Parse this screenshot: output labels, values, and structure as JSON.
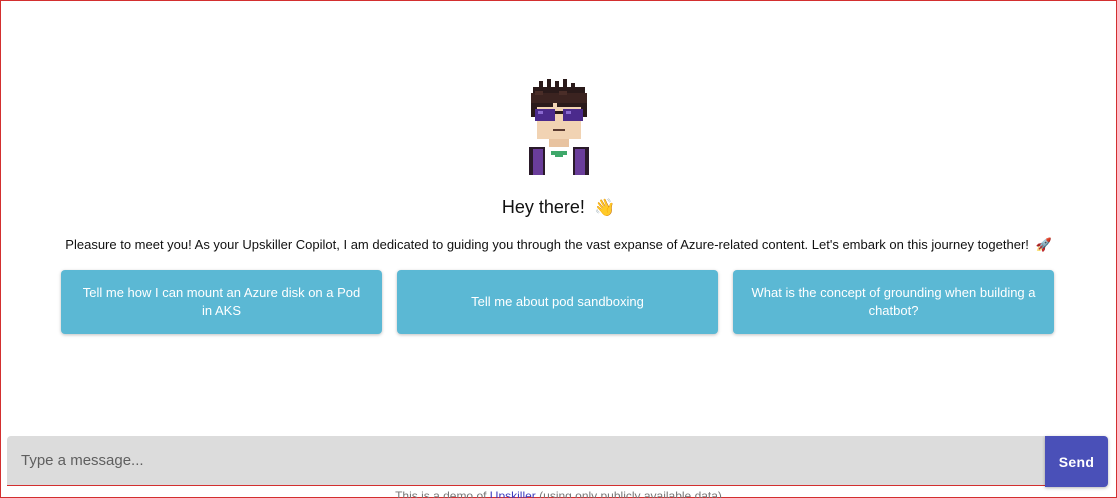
{
  "greeting": {
    "text": "Hey there!",
    "emoji": "👋"
  },
  "intro": {
    "text": "Pleasure to meet you! As your Upskiller Copilot, I am dedicated to guiding you through the vast expanse of Azure-related content. Let's embark on this journey together!",
    "emoji": "🚀"
  },
  "suggestions": [
    {
      "label": "Tell me how I can mount an Azure disk on a Pod in AKS"
    },
    {
      "label": "Tell me about pod sandboxing"
    },
    {
      "label": "What is the concept of grounding when building a chatbot?"
    }
  ],
  "composer": {
    "placeholder": "Type a message...",
    "send_label": "Send"
  },
  "footer": {
    "prefix": "This is a demo of ",
    "link": "Upskiller",
    "suffix": " (using only publicly available data)"
  },
  "colors": {
    "suggestion_bg": "#5bb8d4",
    "send_bg": "#4a50b8",
    "input_bg": "#dcdcdc",
    "frame_border": "#d32f2f"
  },
  "icons": {
    "avatar": "pixel-art-avatar",
    "greeting": "waving-hand",
    "intro": "rocket"
  }
}
